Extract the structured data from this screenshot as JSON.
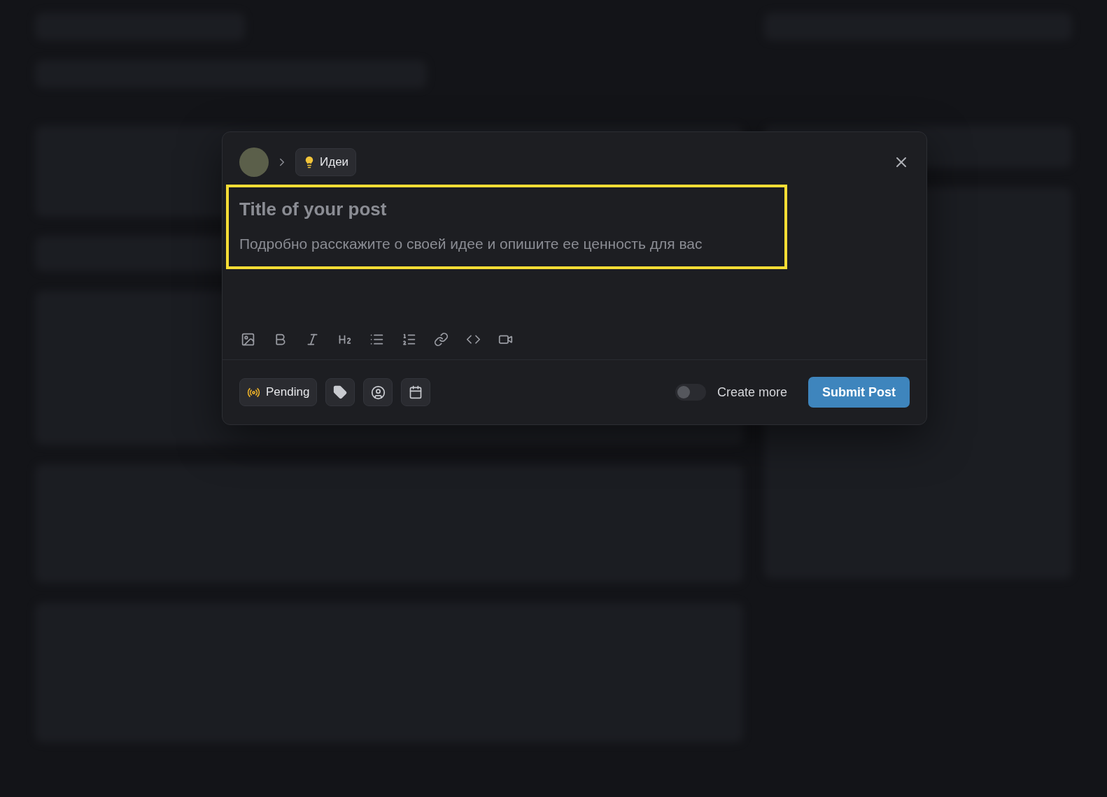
{
  "modal": {
    "category": {
      "label": "Идеи"
    },
    "title": {
      "placeholder": "Title of your post"
    },
    "description": {
      "placeholder": "Подробно расскажите о своей идее и опишите ее ценность для вас"
    },
    "status": {
      "label": "Pending"
    },
    "create_more": {
      "label": "Create more",
      "on": false
    },
    "submit": {
      "label": "Submit Post"
    }
  }
}
